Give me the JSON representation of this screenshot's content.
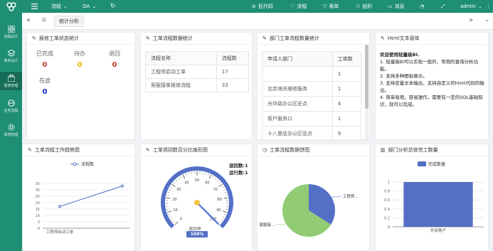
{
  "topbar": {
    "process": "流程",
    "oa": "OA",
    "lowcode": "低代码",
    "flow": "流程",
    "form": "表单",
    "org": "组织",
    "message": "消息",
    "user": "admin"
  },
  "sidebar": {
    "items": [
      {
        "label": "流程设计"
      },
      {
        "label": "表单设计"
      },
      {
        "label": "报表管理"
      },
      {
        "label": "业务流程"
      },
      {
        "label": "系统管理"
      }
    ]
  },
  "tabs": {
    "active": "统计分析"
  },
  "status_card": {
    "title": "报修工单状态统计",
    "items": [
      {
        "label": "已完成",
        "value": "0",
        "color": "#c0392b"
      },
      {
        "label": "待办",
        "value": "0",
        "color": "#e6b800"
      },
      {
        "label": "退回",
        "value": "0",
        "color": "#c0392b"
      },
      {
        "label": "在途",
        "value": "0",
        "color": "#1a2ccc"
      }
    ]
  },
  "flow_stats": {
    "title": "工单流程数据统计",
    "headers": [
      "流程名称",
      "流程数"
    ],
    "rows": [
      [
        "工程师启动工单",
        "17"
      ],
      [
        "客服接单报修流程",
        "33"
      ]
    ]
  },
  "dept_stats": {
    "title": "部门工单流程数量统计",
    "headers": [
      "申请人部门",
      "工单数"
    ],
    "rows": [
      [
        "",
        "1"
      ],
      [
        "北京海关维修服务",
        "1"
      ],
      [
        "光华路办公区驻点",
        "4"
      ],
      [
        "客户服务口",
        "1"
      ],
      [
        "十八里店办公区驻点",
        "9"
      ]
    ]
  },
  "html_card": {
    "title": "Html文本窗体",
    "heading": "欢迎使用轻量级BI.",
    "lines": [
      "1. 轻量级BI可以实现一般的、常用的查询分析功能。",
      "2. 支持多种图标展示。",
      "3. 支持变量文本输出，支持自定义的html代码的输出。",
      "4. 简单易用，容易操作，需要有一定的SQL基础知识，就可以完成。"
    ]
  },
  "line_card": {
    "title": "工单流程工作趋势图"
  },
  "gauge_card": {
    "title": "工单退回数百分比扇形图",
    "returned": "退回数:1",
    "running": "运行数:1",
    "label": "退回率",
    "value_text": "100%"
  },
  "pie_card": {
    "title": "工单流程数据饼图"
  },
  "bar_card": {
    "title": "部门分析总体完工数量"
  },
  "chart_data": [
    {
      "type": "line",
      "title": "",
      "legend": [
        "流程数"
      ],
      "categories": [
        "工程师启动工单",
        ""
      ],
      "series": [
        {
          "name": "流程数",
          "values": [
            17,
            33
          ]
        }
      ],
      "ylim": [
        0,
        35
      ],
      "yticks": [
        "0",
        "5",
        "10",
        "15",
        "20",
        "25",
        "30",
        "35"
      ]
    },
    {
      "type": "gauge",
      "value": 100,
      "range": [
        0,
        100
      ],
      "ticks": [
        "0",
        "10",
        "20",
        "30",
        "40",
        "50",
        "60",
        "70",
        "80",
        "90",
        "100"
      ]
    },
    {
      "type": "pie",
      "slices": [
        {
          "name": "工程师...",
          "value": 17,
          "color": "#5470c6"
        },
        {
          "name": "客服接...",
          "value": 33,
          "color": "#91cc75"
        }
      ]
    },
    {
      "type": "bar",
      "legend": [
        "完成数量"
      ],
      "categories": [
        "外部客户"
      ],
      "values": [
        1
      ],
      "ylim": [
        0,
        1
      ],
      "yticks": [
        "0",
        "0.2",
        "0.4",
        "0.6",
        "0.8",
        "1"
      ]
    }
  ]
}
